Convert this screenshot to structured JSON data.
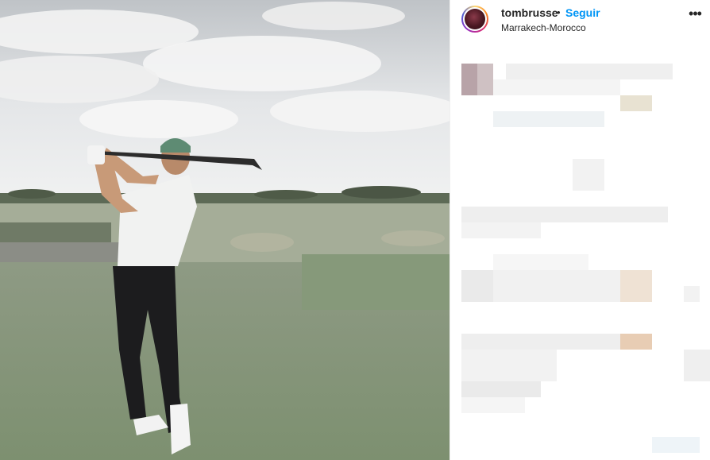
{
  "post": {
    "username": "tombrusse",
    "separator": "•",
    "follow_label": "Seguir",
    "location": "Marrakech-Morocco",
    "more_icon": "more-horizontal-icon",
    "more_label": "•••"
  },
  "photo": {
    "subject": "golfer-photo"
  },
  "colors": {
    "follow": "#0095f6",
    "text": "#262626"
  }
}
